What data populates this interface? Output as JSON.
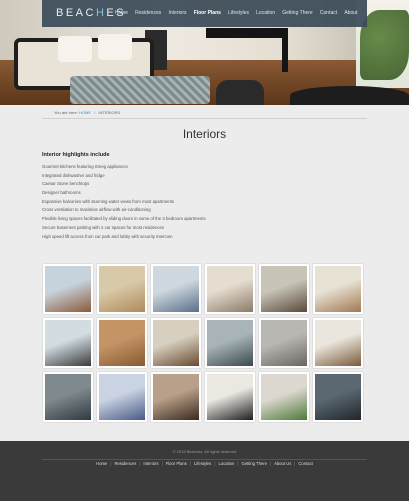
{
  "logo": {
    "prefix": "BEAC",
    "accent": "H",
    "suffix": "ES"
  },
  "nav": {
    "items": [
      {
        "label": "Home"
      },
      {
        "label": "Residences"
      },
      {
        "label": "Interiors"
      },
      {
        "label": "Floor Plans"
      },
      {
        "label": "Lifestyles"
      },
      {
        "label": "Location"
      },
      {
        "label": "Getting There"
      },
      {
        "label": "Contact"
      },
      {
        "label": "About"
      }
    ],
    "active_index": 3
  },
  "breadcrumb": {
    "prefix": "You are here:",
    "home": "HOME",
    "separator": "/",
    "current": "INTERIORS"
  },
  "page_title": "Interiors",
  "highlights": {
    "heading": "Interior highlights include",
    "items": [
      "Gourmet kitchens featuring Smeg appliances",
      "Integrated dishwasher and fridge",
      "Caesar Stone benchtops",
      "Designer bathrooms",
      "Expansive balconies with stunning water views from most apartments",
      "Cross ventilation to maximise airflow with air-conditioning",
      "Flexible living spaces facilitated by sliding doors in some of the 3 bedroom apartments",
      "Secure basement parking with 2 car spaces for most residences",
      "High speed lift access from car park and lobby with security intercom"
    ]
  },
  "gallery": {
    "thumbs": [
      {
        "name": "living-room-photo",
        "c1": "#c7d3dc",
        "c2": "#8a5a3a"
      },
      {
        "name": "lounge-art-photo",
        "c1": "#d8c9a8",
        "c2": "#b08a5a"
      },
      {
        "name": "bedroom-blue-photo",
        "c1": "#cfd8de",
        "c2": "#5a6f8a"
      },
      {
        "name": "bedroom-photo",
        "c1": "#e4ddd0",
        "c2": "#8c7a66"
      },
      {
        "name": "balcony-view-photo",
        "c1": "#c8c4b8",
        "c2": "#5a4a3a"
      },
      {
        "name": "master-bedroom-photo",
        "c1": "#e8e2d4",
        "c2": "#a07a52"
      },
      {
        "name": "view-photo",
        "c1": "#d2dde2",
        "c2": "#3a3a3a"
      },
      {
        "name": "wood-door-photo",
        "c1": "#c29466",
        "c2": "#8a5a30"
      },
      {
        "name": "dining-photo",
        "c1": "#d7d0c0",
        "c2": "#6a4a30"
      },
      {
        "name": "glass-balcony-photo",
        "c1": "#a8b4b8",
        "c2": "#3b4a4f"
      },
      {
        "name": "bathroom-photo",
        "c1": "#b9b7b2",
        "c2": "#6a6560"
      },
      {
        "name": "kitchen-photo",
        "c1": "#eae6dd",
        "c2": "#7a5a3a"
      },
      {
        "name": "bathroom-vanity-photo",
        "c1": "#7e8a8e",
        "c2": "#2e3a40"
      },
      {
        "name": "blue-bedroom-photo",
        "c1": "#c9d3e2",
        "c2": "#4a5a86"
      },
      {
        "name": "stairs-photo",
        "c1": "#b9a08a",
        "c2": "#3a2a1e"
      },
      {
        "name": "white-bedroom-photo",
        "c1": "#ebe8e2",
        "c2": "#1e1e1e"
      },
      {
        "name": "lounge-green-photo",
        "c1": "#dcd8cf",
        "c2": "#4f7a3a"
      },
      {
        "name": "staircase-glass-photo",
        "c1": "#5b6872",
        "c2": "#20262a"
      }
    ]
  },
  "footer": {
    "copyright": "© 2015 Beaches. All rights reserved",
    "links": [
      {
        "label": "Home"
      },
      {
        "label": "Residences"
      },
      {
        "label": "Interiors"
      },
      {
        "label": "Floor Plans"
      },
      {
        "label": "Lifestyles"
      },
      {
        "label": "Location"
      },
      {
        "label": "Getting There"
      },
      {
        "label": "About Us"
      },
      {
        "label": "Contact"
      }
    ]
  }
}
